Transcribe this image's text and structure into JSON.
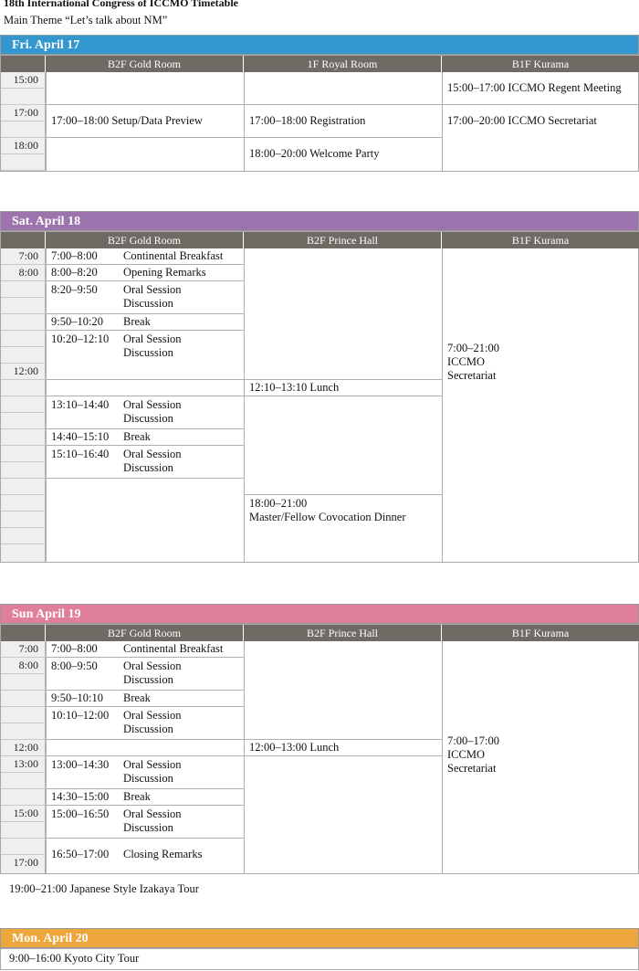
{
  "header": {
    "title": "18th International Congress of ICCMO  Timetable",
    "theme": "Main Theme “Let’s talk about NM”"
  },
  "colors": {
    "fri": "#3398d0",
    "sat": "#9c73ac",
    "sun": "#e07f9a",
    "mon": "#eda63c",
    "room_header": "#6f6a63"
  },
  "fri": {
    "day": "Fri. April 17",
    "rooms": [
      "B2F Gold Room",
      "1F Royal Room",
      "B1F Kurama"
    ],
    "times": [
      "15:00",
      "17:00",
      "18:00"
    ],
    "gold": "17:00–18:00  Setup/Data Preview",
    "royal1": "17:00–18:00  Registration",
    "royal2": "18:00–20:00 Welcome Party",
    "kurama1": "15:00–17:00 ICCMO Regent Meeting",
    "kurama2": "17:00–20:00 ICCMO Secretariat"
  },
  "sat": {
    "day": "Sat. April 18",
    "rooms": [
      "B2F Gold Room",
      "B2F Prince Hall",
      "B1F Kurama"
    ],
    "times": [
      "7:00",
      "8:00",
      "12:00"
    ],
    "events": [
      {
        "time": "7:00–8:00",
        "title": "Continental Breakfast"
      },
      {
        "time": "8:00–8:20",
        "title": "Opening Remarks"
      },
      {
        "time": "8:20–9:50",
        "title": "Oral Session",
        "sub": "Discussion"
      },
      {
        "time": "9:50–10:20",
        "title": "Break"
      },
      {
        "time": "10:20–12:10",
        "title": "Oral Session",
        "sub": "Discussion"
      },
      {
        "time": "13:10–14:40",
        "title": "Oral Session",
        "sub": "Discussion"
      },
      {
        "time": "14:40–15:10",
        "title": "Break"
      },
      {
        "time": "15:10–16:40",
        "title": "Oral Session",
        "sub": "Discussion"
      }
    ],
    "lunch": "12:10–13:10 Lunch",
    "dinner_time": "18:00–21:00",
    "dinner": "Master/Fellow Covocation Dinner",
    "kurama": [
      "7:00–21:00",
      "ICCMO",
      "Secretariat"
    ]
  },
  "sun": {
    "day": "Sun April 19",
    "rooms": [
      "B2F Gold Room",
      "B2F Prince Hall",
      "B1F Kurama"
    ],
    "times": [
      "7:00",
      "8:00",
      "12:00",
      "13:00",
      "15:00",
      "17:00"
    ],
    "events": [
      {
        "time": "7:00–8:00",
        "title": "Continental Breakfast"
      },
      {
        "time": "8:00–9:50",
        "title": "Oral Session",
        "sub": "Discussion"
      },
      {
        "time": "9:50–10:10",
        "title": "Break"
      },
      {
        "time": "10:10–12:00",
        "title": "Oral Session",
        "sub": "Discussion"
      },
      {
        "time": "13:00–14:30",
        "title": "Oral Session",
        "sub": "Discussion"
      },
      {
        "time": "14:30–15:00",
        "title": "Break"
      },
      {
        "time": "15:00–16:50",
        "title": "Oral Session",
        "sub": "Discussion"
      },
      {
        "time": "16:50–17:00",
        "title": "Closing Remarks"
      }
    ],
    "lunch": "12:00–13:00 Lunch",
    "kurama": [
      "7:00–17:00",
      "ICCMO",
      "Secretariat"
    ],
    "tour": "19:00–21:00  Japanese Style Izakaya Tour"
  },
  "mon": {
    "day": "Mon. April 20",
    "tour": "9:00–16:00  Kyoto City Tour"
  }
}
